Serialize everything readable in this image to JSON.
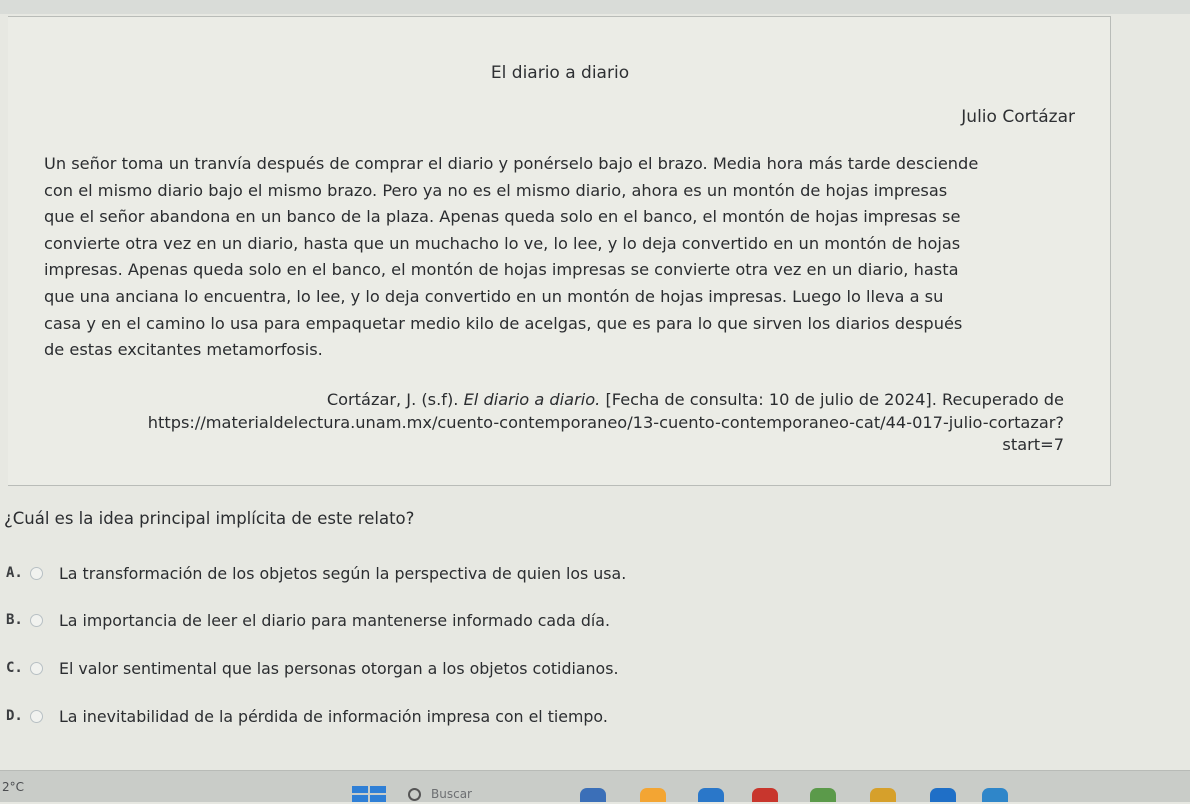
{
  "passage": {
    "title": "El diario a diario",
    "author": "Julio Cortázar",
    "body_lines": [
      "Un señor toma un tranvía después de comprar el diario y ponérselo bajo el brazo. Media hora más tarde desciende",
      "con el mismo diario bajo el mismo brazo. Pero ya no es el mismo diario, ahora es un montón de hojas impresas",
      "que el señor abandona en un banco de la plaza. Apenas queda solo en el banco, el montón de hojas impresas se",
      "convierte otra vez en un diario, hasta que un muchacho lo ve, lo lee, y lo deja convertido en un montón de hojas",
      "impresas. Apenas queda solo en el banco, el montón de hojas impresas se convierte otra vez en un diario, hasta",
      "que una anciana lo encuentra, lo lee, y lo deja convertido en un montón de hojas impresas. Luego lo lleva a su",
      "casa y en el camino lo usa para empaquetar medio kilo de acelgas, que es para lo que sirven los diarios después",
      "de estas excitantes metamorfosis."
    ],
    "citation": {
      "prefix": "Cortázar, J. (s.f). ",
      "work_title": "El diario a diario.",
      "suffix": " [Fecha de consulta: 10 de julio de 2024]. Recuperado de",
      "url_line": "https://materialdelectura.unam.mx/cuento-contemporaneo/13-cuento-contemporaneo-cat/44-017-julio-cortazar?",
      "url_tail": "start=7"
    }
  },
  "question": {
    "text": "¿Cuál es la idea principal implícita de este relato?",
    "options": [
      {
        "letter": "A.",
        "text": "La transformación de los objetos según la perspectiva de quien los usa."
      },
      {
        "letter": "B.",
        "text": "La importancia de leer el diario para mantenerse informado cada día."
      },
      {
        "letter": "C.",
        "text": "El valor sentimental que las personas otorgan a los objetos cotidianos."
      },
      {
        "letter": "D.",
        "text": "La inevitabilidad de la pérdida de información impresa con el tiempo."
      }
    ]
  },
  "taskbar": {
    "weather": "2°C",
    "search_placeholder": "Buscar"
  },
  "colors": {
    "start_blue": "#2f7fd6",
    "icon_1": "#3b6fb8",
    "icon_2": "#f3a533",
    "icon_3": "#2a77c9",
    "icon_4": "#c8362d",
    "icon_5": "#5b9a4a",
    "icon_6": "#d6a02b",
    "icon_7": "#1f6fc7",
    "icon_8": "#2f86c9"
  }
}
